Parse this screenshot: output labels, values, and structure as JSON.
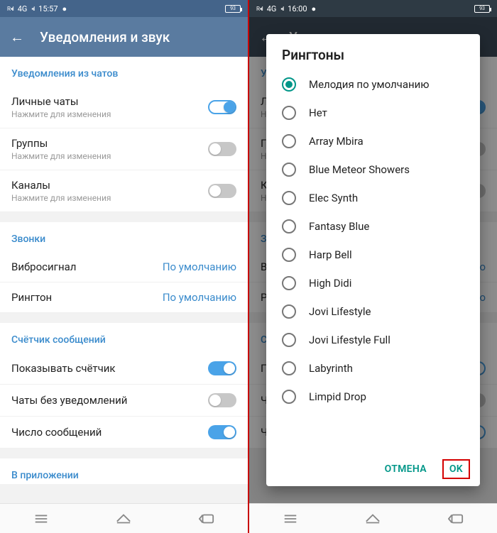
{
  "left": {
    "status": {
      "net": "4G",
      "time": "15:57",
      "batt": "93"
    },
    "header": {
      "title": "Уведомления и звук"
    },
    "sections": {
      "chats": {
        "title": "Уведомления из чатов",
        "private": {
          "title": "Личные чаты",
          "sub": "Нажмите для изменения"
        },
        "groups": {
          "title": "Группы",
          "sub": "Нажмите для изменения"
        },
        "channels": {
          "title": "Каналы",
          "sub": "Нажмите для изменения"
        }
      },
      "calls": {
        "title": "Звонки",
        "vibro": {
          "title": "Вибросигнал",
          "value": "По умолчанию"
        },
        "ringtone": {
          "title": "Рингтон",
          "value": "По умолчанию"
        }
      },
      "counter": {
        "title": "Счётчик сообщений",
        "show": {
          "title": "Показывать счётчик"
        },
        "nounot": {
          "title": "Чаты без уведомлений"
        },
        "count": {
          "title": "Число сообщений"
        }
      },
      "inapp": {
        "title": "В приложении"
      }
    }
  },
  "right": {
    "status": {
      "net": "4G",
      "time": "16:00",
      "batt": "93"
    },
    "dialog": {
      "title": "Рингтоны",
      "options": [
        "Мелодия по умолчанию",
        "Нет",
        "Array Mbira",
        "Blue Meteor Showers",
        "Elec Synth",
        "Fantasy Blue",
        "Harp Bell",
        "High Didi",
        "Jovi Lifestyle",
        "Jovi Lifestyle Full",
        "Labyrinth",
        "Limpid Drop"
      ],
      "selected_index": 0,
      "cancel": "ОТМЕНА",
      "ok": "OK"
    }
  }
}
